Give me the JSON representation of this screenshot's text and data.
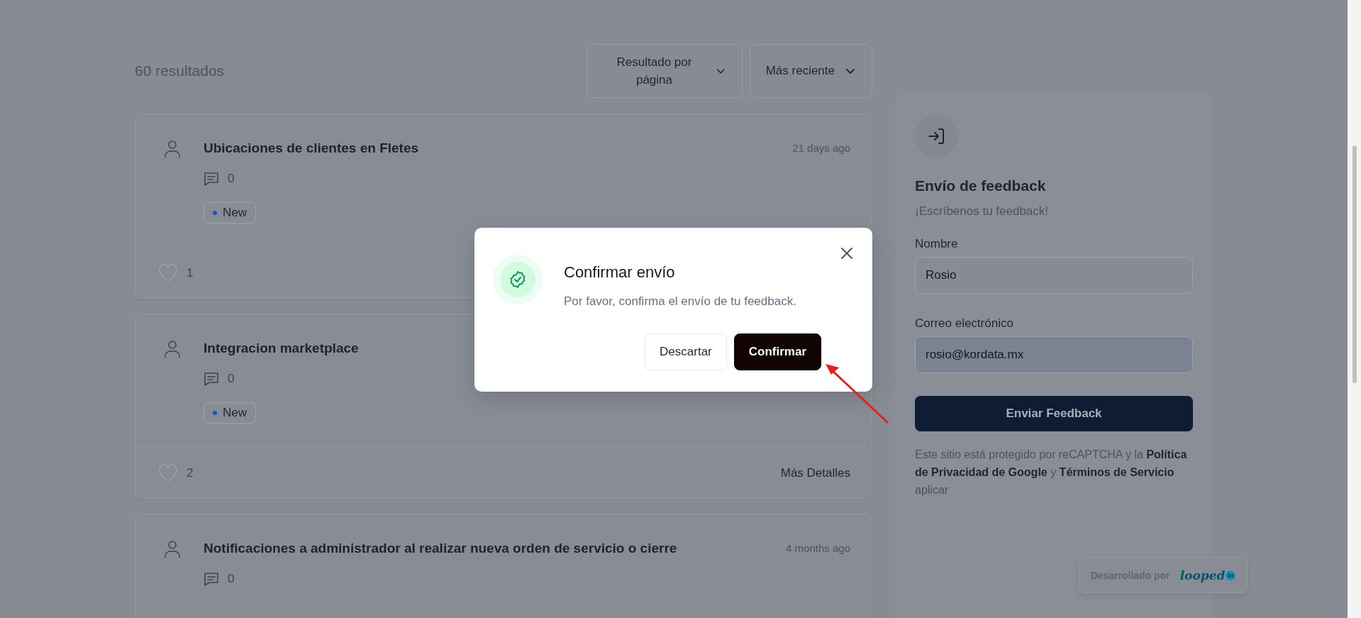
{
  "results_count": "60 resultados",
  "sort_controls": [
    {
      "label": "Resultado por página"
    },
    {
      "label": "Más reciente"
    }
  ],
  "posts": [
    {
      "title": "Ubicaciones de clientes en Fletes",
      "time": "21 days ago",
      "comments": "0",
      "status": "New",
      "likes": "1"
    },
    {
      "title": "Integracion marketplace",
      "comments": "0",
      "status": "New",
      "likes": "2",
      "details": "Más Detalles"
    },
    {
      "title": "Notificaciones a administrador al realizar nueva orden de servicio o cierre",
      "time": "4 months ago",
      "comments": "0"
    }
  ],
  "feedback_panel": {
    "title": "Envío de feedback",
    "subtitle": "¡Escríbenos tu feedback!",
    "fields": [
      {
        "label": "Nombre",
        "value": "Rosio",
        "autofilled": false
      },
      {
        "label": "Correo electrónico",
        "value": "rosio@kordata.mx",
        "autofilled": true
      }
    ],
    "submit": "Enviar Feedback",
    "notice": "Este sitio está protegido por reCAPTCHA y la **Política de Privacidad de Google** y **Términos de Servicio** aplicar"
  },
  "powered_by": {
    "label": "Desarrollado por",
    "logo": "looped",
    "logo_mark": "in"
  },
  "dialog": {
    "title": "Confirmar envío",
    "message": "Por favor, confirma el envío de tu feedback.",
    "buttons": [
      {
        "label": "Descartar",
        "kind": "secondary"
      },
      {
        "label": "Confirmar",
        "kind": "primary"
      }
    ]
  }
}
